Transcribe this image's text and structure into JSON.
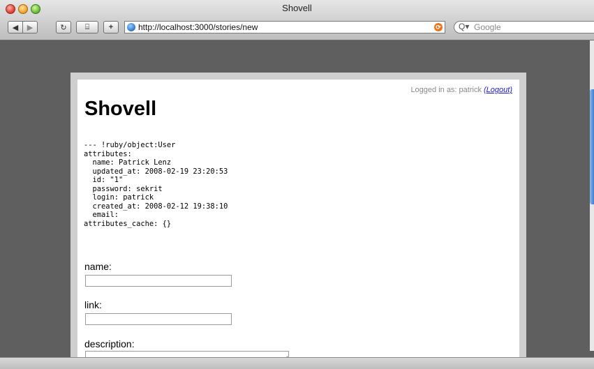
{
  "window": {
    "title": "Shovell"
  },
  "toolbar": {
    "back_icon": "back-arrow-icon",
    "forward_icon": "forward-arrow-icon",
    "reload_icon": "reload-icon",
    "snapback_icon": "snapback-icon",
    "add_bookmark_icon": "plus-icon",
    "address": "http://localhost:3000/stories/new",
    "search_placeholder": "Google"
  },
  "page": {
    "login_text": "Logged in as: patrick",
    "logout_label": "(Logout)",
    "title": "Shovell",
    "debug_dump": "--- !ruby/object:User\nattributes:\n  name: Patrick Lenz\n  updated_at: 2008-02-19 23:20:53\n  id: \"1\"\n  password: sekrit\n  login: patrick\n  created_at: 2008-02-12 19:38:10\n  email: \nattributes_cache: {}",
    "form": {
      "name_label": "name:",
      "link_label": "link:",
      "description_label": "description:"
    }
  },
  "colors": {
    "link": "#1a1adb",
    "background": "#5f5f5f"
  }
}
